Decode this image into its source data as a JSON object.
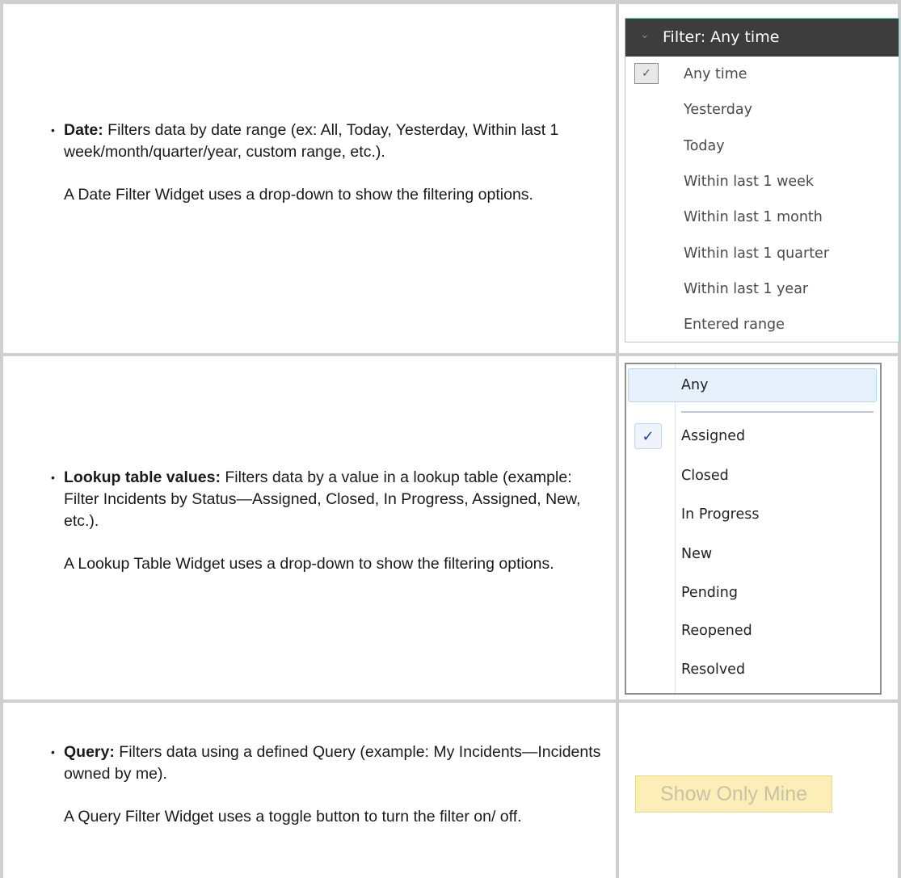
{
  "rows": {
    "date": {
      "term": "Date:",
      "desc": " Filters data by date range (ex: All, Today, Yesterday, Within last 1 week/month/quarter/year, custom range, etc.).",
      "note": "A Date Filter Widget uses a drop-down to show the filtering options."
    },
    "lookup": {
      "term": "Lookup table values:",
      "desc": " Filters data by a value in a lookup table (example: Filter Incidents by Status—Assigned, Closed, In Progress, Assigned, New, etc.).",
      "note": "A Lookup Table Widget uses a drop-down to show the filtering options."
    },
    "query": {
      "term": "Query:",
      "desc": " Filters data using a defined Query (example: My Incidents—Incidents owned by me).",
      "note": "A Query Filter Widget uses a toggle button to turn the filter on/ off."
    }
  },
  "date_filter": {
    "header": "Filter: Any time",
    "selected": "Any time",
    "options": [
      "Any time",
      "Yesterday",
      "Today",
      "Within last 1 week",
      "Within last 1 month",
      "Within last 1 quarter",
      "Within last 1 year",
      "Entered range"
    ]
  },
  "lookup_filter": {
    "top_option": "Any",
    "selected": "Assigned",
    "options": [
      "Assigned",
      "Closed",
      "In Progress",
      "New",
      "Pending",
      "Reopened",
      "Resolved"
    ]
  },
  "query_filter": {
    "button_label": "Show Only Mine"
  },
  "icons": {
    "bullet": "bullet",
    "checkmark": "check-icon",
    "chevron": "chevron-down-icon"
  }
}
